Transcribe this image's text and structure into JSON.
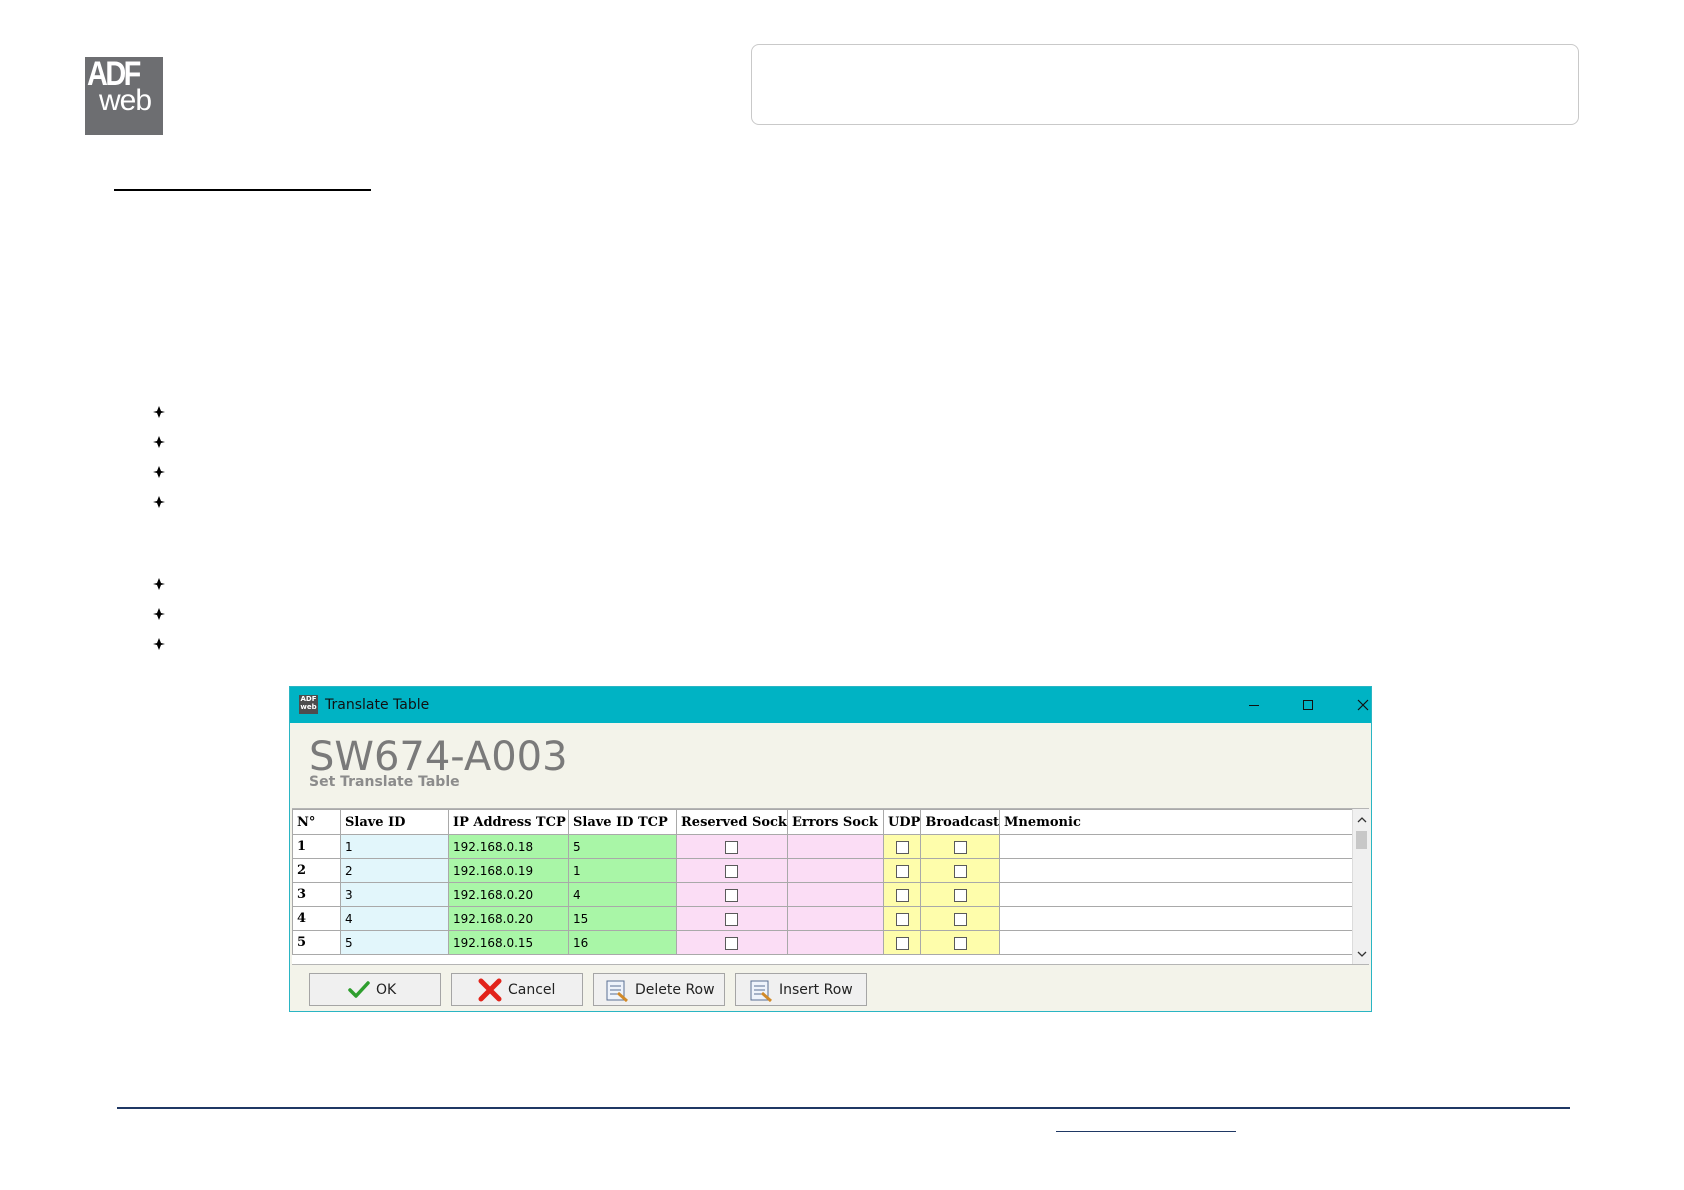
{
  "logo": {
    "line1": "ADF",
    "line2": "web"
  },
  "dialog": {
    "window_title": "Translate Table",
    "app_icon_text": "ADF web",
    "heading": "SW674-A003",
    "subheading": "Set Translate Table",
    "columns": [
      "N°",
      "Slave ID",
      "IP Address TCP",
      "Slave ID TCP",
      "Reserved Sock",
      "Errors Sock",
      "UDP",
      "Broadcast",
      "Mnemonic"
    ],
    "rows": [
      {
        "n": "1",
        "slave_id": "1",
        "ip": "192.168.0.18",
        "slave_id_tcp": "5",
        "reserved_sock": false,
        "errors_sock": "",
        "udp": false,
        "broadcast": false,
        "mnemonic": ""
      },
      {
        "n": "2",
        "slave_id": "2",
        "ip": "192.168.0.19",
        "slave_id_tcp": "1",
        "reserved_sock": false,
        "errors_sock": "",
        "udp": false,
        "broadcast": false,
        "mnemonic": ""
      },
      {
        "n": "3",
        "slave_id": "3",
        "ip": "192.168.0.20",
        "slave_id_tcp": "4",
        "reserved_sock": false,
        "errors_sock": "",
        "udp": false,
        "broadcast": false,
        "mnemonic": ""
      },
      {
        "n": "4",
        "slave_id": "4",
        "ip": "192.168.0.20",
        "slave_id_tcp": "15",
        "reserved_sock": false,
        "errors_sock": "",
        "udp": false,
        "broadcast": false,
        "mnemonic": ""
      },
      {
        "n": "5",
        "slave_id": "5",
        "ip": "192.168.0.15",
        "slave_id_tcp": "16",
        "reserved_sock": false,
        "errors_sock": "",
        "udp": false,
        "broadcast": false,
        "mnemonic": ""
      }
    ],
    "buttons": {
      "ok": "OK",
      "cancel": "Cancel",
      "delete_row": "Delete Row",
      "insert_row": "Insert Row"
    },
    "icons": {
      "window": [
        "app-icon",
        "minimize-icon",
        "maximize-icon",
        "close-icon"
      ],
      "scrollbar": [
        "scroll-up-icon",
        "scroll-down-icon"
      ],
      "buttons": [
        "checkmark-icon",
        "cancel-x-icon",
        "delete-row-icon",
        "insert-row-icon"
      ]
    }
  },
  "colors": {
    "titlebar": "#00b3c4",
    "slave_id_col": "#e2f6fb",
    "tcp_cols": "#a9f6a7",
    "sock_cols": "#fbddf5",
    "udp_broadcast_cols": "#fefdab",
    "footer_line": "#1f3864"
  }
}
